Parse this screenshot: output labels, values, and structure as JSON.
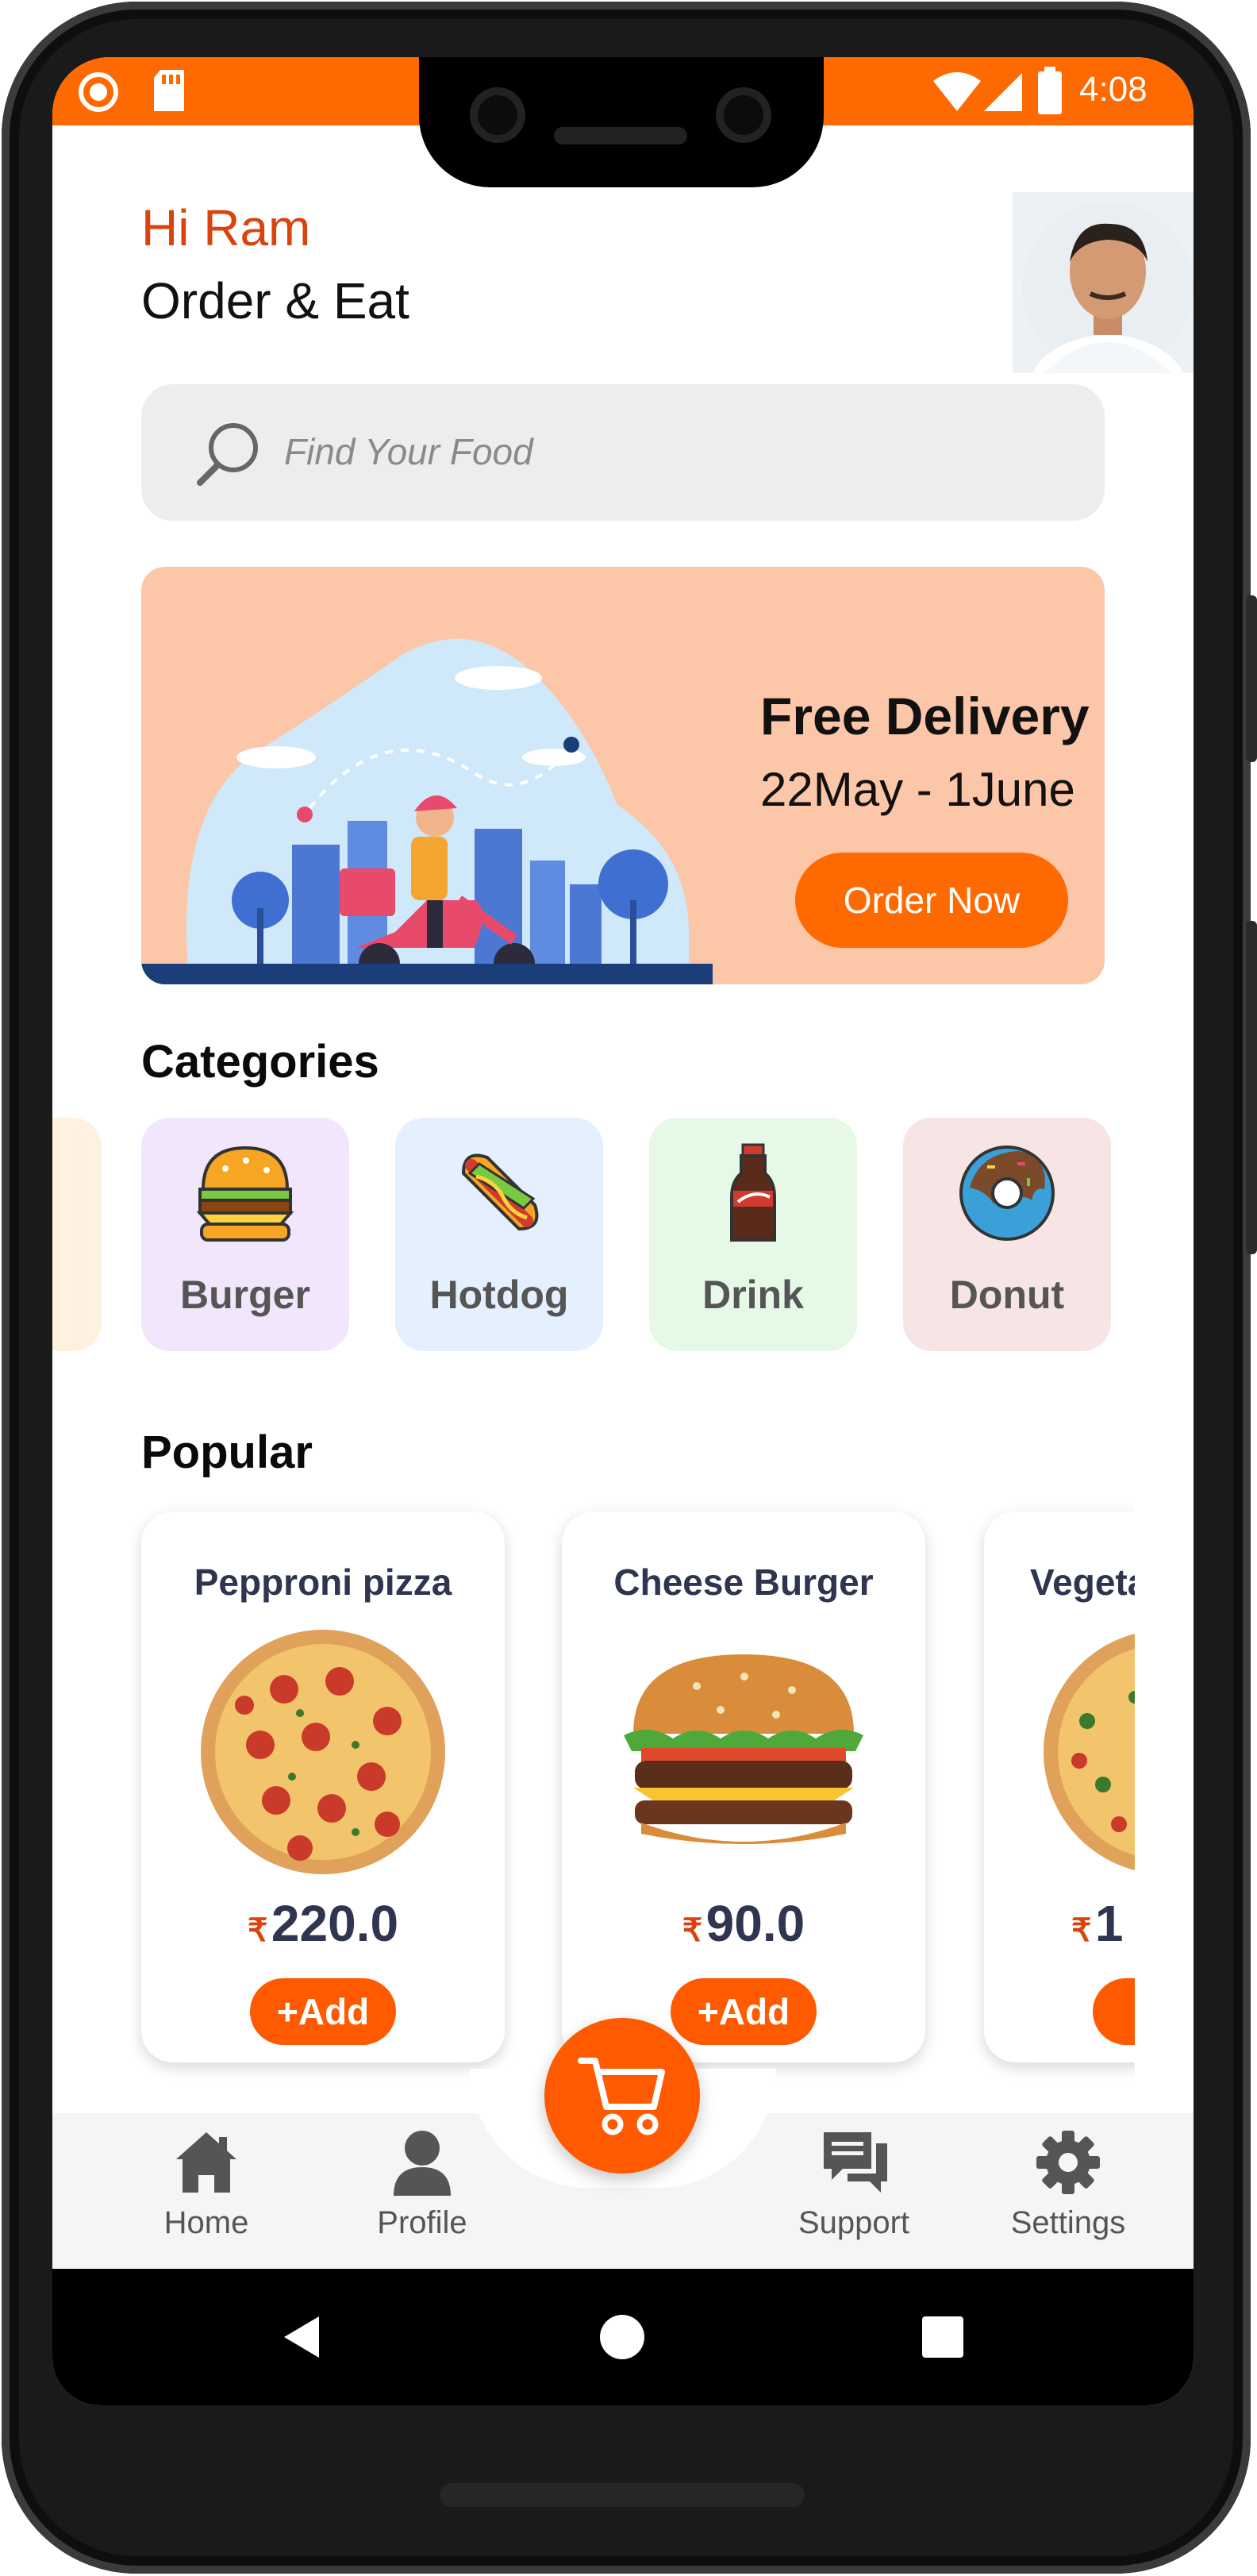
{
  "status_bar": {
    "time": "4:08"
  },
  "header": {
    "greeting": "Hi Ram",
    "subtitle": "Order & Eat"
  },
  "search": {
    "placeholder": "Find Your Food"
  },
  "promo": {
    "title": "Free Delivery",
    "dates": "22May - 1June",
    "cta": "Order Now"
  },
  "categories": {
    "title": "Categories",
    "items": [
      {
        "label": "Burger",
        "bg": "#f1e6fb"
      },
      {
        "label": "Hotdog",
        "bg": "#e4f0fd"
      },
      {
        "label": "Drink",
        "bg": "#e6f8e6"
      },
      {
        "label": "Donut",
        "bg": "#f7e4e4"
      }
    ]
  },
  "popular": {
    "title": "Popular",
    "items": [
      {
        "name": "Pepproni pizza",
        "currency": "₹",
        "price": "220.0",
        "add": "+Add"
      },
      {
        "name": "Cheese Burger",
        "currency": "₹",
        "price": "90.0",
        "add": "+Add"
      },
      {
        "name": "Vegeta",
        "currency": "₹",
        "price": "1",
        "add": "+"
      }
    ]
  },
  "nav": {
    "home": "Home",
    "profile": "Profile",
    "support": "Support",
    "settings": "Settings"
  },
  "colors": {
    "accent": "#ff6a00",
    "greeting": "#d9430e",
    "banner": "#fcc6a8"
  }
}
